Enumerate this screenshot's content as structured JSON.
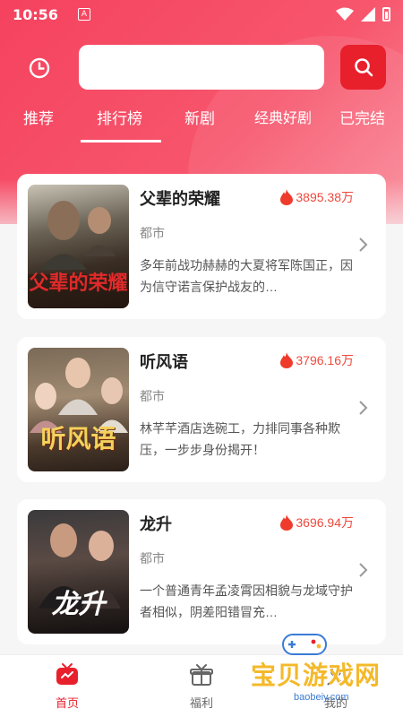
{
  "status_bar": {
    "time": "10:56",
    "notification_badge": "A"
  },
  "search": {
    "placeholder": "",
    "value": ""
  },
  "tabs": [
    {
      "label": "推荐",
      "active": false
    },
    {
      "label": "排行榜",
      "active": true
    },
    {
      "label": "新剧",
      "active": false
    },
    {
      "label": "经典好剧",
      "active": false
    },
    {
      "label": "已完结",
      "active": false
    }
  ],
  "cards": [
    {
      "title": "父辈的荣耀",
      "heat": "3895.38万",
      "genre": "都市",
      "description": "多年前战功赫赫的大夏将军陈国正，因为信守诺言保护战友的…",
      "poster_text": "父辈的荣耀"
    },
    {
      "title": "听风语",
      "heat": "3796.16万",
      "genre": "都市",
      "description": "林芊芊酒店选碗工，力排同事各种欺压，一步步身份揭开！",
      "poster_text": "听风语"
    },
    {
      "title": "龙升",
      "heat": "3696.94万",
      "genre": "都市",
      "description": "一个普通青年孟凌霄因相貌与龙域守护者相似，阴差阳错冒充…",
      "poster_text": "龙升"
    }
  ],
  "bottom_nav": [
    {
      "label": "首页",
      "active": true
    },
    {
      "label": "福利",
      "active": false
    },
    {
      "label": "我的",
      "active": false
    }
  ],
  "watermark": {
    "text": "宝贝游戏网",
    "url": "baobeiy.com"
  },
  "colors": {
    "accent": "#e8202c",
    "header_gradient_start": "#f5425e",
    "heat": "#ee4a3c"
  }
}
